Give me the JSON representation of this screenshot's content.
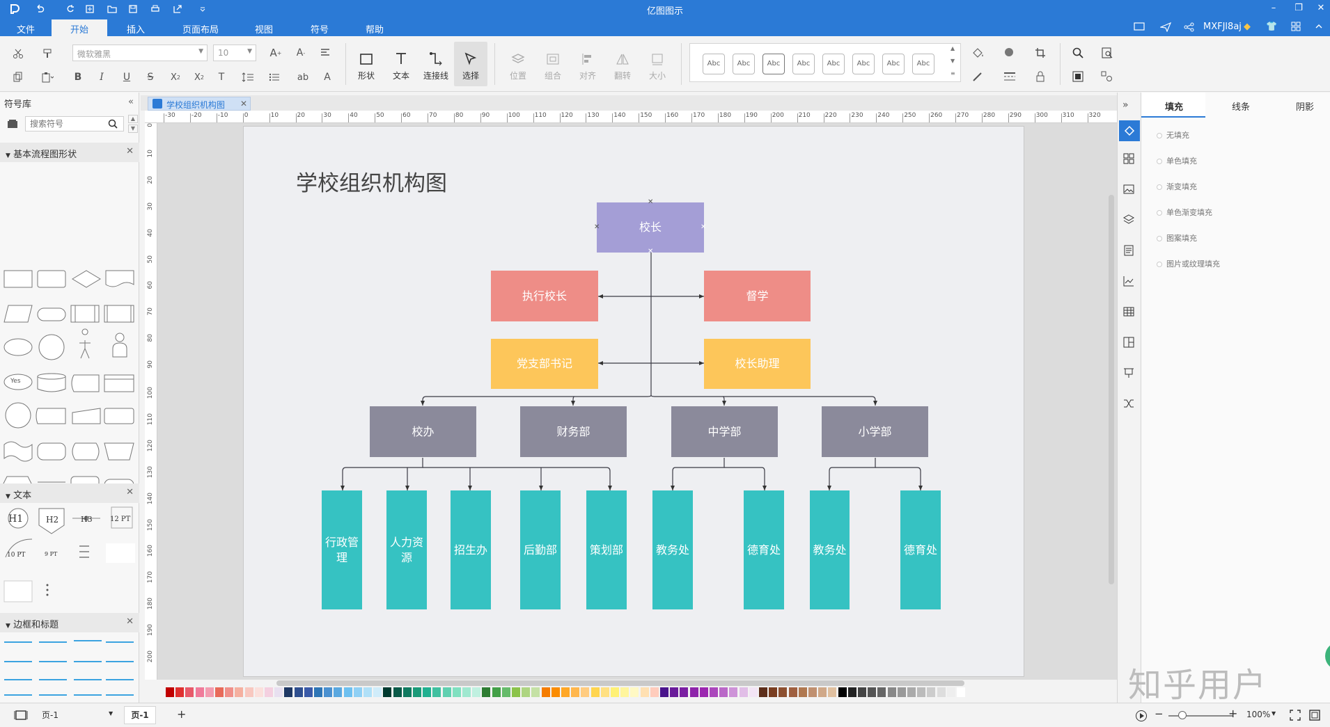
{
  "app": {
    "title": "亿图图示"
  },
  "menu": {
    "items": [
      "文件",
      "开始",
      "插入",
      "页面布局",
      "视图",
      "符号",
      "帮助"
    ],
    "active": "开始",
    "user": "MXFJl8aj"
  },
  "ribbon": {
    "font_name": "微软雅黑",
    "font_size": "10",
    "tools": {
      "shape": "形状",
      "text": "文本",
      "connector": "连接线",
      "select": "选择"
    },
    "disabled_tools": {
      "position": "位置",
      "group": "组合",
      "align": "对齐",
      "flip": "翻转",
      "size": "大小"
    },
    "style_sample": "Abc"
  },
  "left_panel": {
    "title": "符号库",
    "search_placeholder": "搜索符号",
    "sections": {
      "flowchart": "基本流程图形状",
      "text": "文本",
      "borders": "边框和标题"
    },
    "text_samples": {
      "h1": "H1",
      "h2": "H2",
      "h3": "H3",
      "pt12": "12 PT",
      "pt10": "10 PT",
      "pt9": "9 PT",
      "yes": "Yes"
    }
  },
  "document": {
    "tab": "学校组织机构图"
  },
  "ruler": {
    "h_ticks": [
      "-30",
      "-20",
      "-10",
      "0",
      "10",
      "20",
      "30",
      "40",
      "50",
      "60",
      "70",
      "80",
      "90",
      "100",
      "110",
      "120",
      "130",
      "140",
      "150",
      "160",
      "170",
      "180",
      "190",
      "200",
      "210",
      "220",
      "230",
      "240",
      "250",
      "260",
      "270",
      "280",
      "290",
      "300",
      "310",
      "320"
    ],
    "v_ticks": [
      "0",
      "10",
      "20",
      "30",
      "40",
      "50",
      "60",
      "70",
      "80",
      "90",
      "100",
      "110",
      "120",
      "130",
      "140",
      "150",
      "160",
      "170",
      "180",
      "190",
      "200"
    ]
  },
  "diagram": {
    "title": "学校组织机构图",
    "principal": "校长",
    "executive_principal": "执行校长",
    "supervisor": "督学",
    "party_secretary": "党支部书记",
    "principal_assistant": "校长助理",
    "departments": [
      "校办",
      "财务部",
      "中学部",
      "小学部"
    ],
    "units": [
      "行政管理",
      "人力资源",
      "招生办",
      "后勤部",
      "策划部",
      "教务处",
      "德育处",
      "教务处",
      "德育处"
    ],
    "colors": {
      "principal": "#a49ed6",
      "level2": "#ee8d87",
      "level3": "#fdc65a",
      "departments": "#8b8a9b",
      "units": "#36c2c2"
    }
  },
  "right_panel": {
    "tabs": [
      "填充",
      "线条",
      "阴影"
    ],
    "fill_options": [
      "无填充",
      "单色填充",
      "渐变填充",
      "单色渐变填充",
      "图案填充",
      "图片或纹理填充"
    ]
  },
  "status": {
    "page_selector": "页-1",
    "page_tab": "页-1",
    "zoom": "100%"
  },
  "watermark": "知乎用户"
}
